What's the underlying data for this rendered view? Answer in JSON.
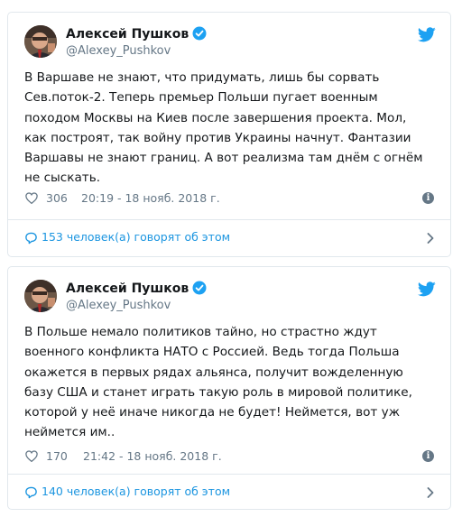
{
  "colors": {
    "link_blue": "#1b95e0",
    "twitter_blue": "#1da1f2",
    "text": "#14171a",
    "muted": "#657786",
    "border": "#e1e8ed"
  },
  "tweets": [
    {
      "author_name": "Алексей Пушков",
      "handle": "@Alexey_Pushkov",
      "verified": true,
      "text": "В Варшаве не знают, что придумать, лишь бы сорвать\nСев.поток-2. Теперь премьер Польши пугает военным\nпоходом Москвы на Киев после завершения проекта. Мол,\nкак построят, так войну против Украины начнут. Фантазии\nВаршавы не знают границ. А вот реализма там днём с огнём\nне сыскать.",
      "likes": "306",
      "timestamp": "20:19 - 18 нояб. 2018 г.",
      "conversation": "153 человек(а) говорят об этом",
      "icons": [
        "avatar",
        "verified-icon",
        "twitter-bird-icon",
        "heart-icon",
        "info-icon",
        "reply-bubble-icon",
        "chevron-right-icon"
      ]
    },
    {
      "author_name": "Алексей Пушков",
      "handle": "@Alexey_Pushkov",
      "verified": true,
      "text": "В Польше немало политиков тайно, но страстно ждут\nвоенного конфликта НАТО с Россией. Ведь тогда Польша\nокажется в первых рядах альянса, получит вожделенную\nбазу США и станет играть такую роль в мировой политике,\nкоторой у неё иначе никогда не будет! Неймется, вот уж\nнеймется им..",
      "likes": "170",
      "timestamp": "21:42 - 18 нояб. 2018 г.",
      "conversation": "140 человек(а) говорят об этом",
      "icons": [
        "avatar",
        "verified-icon",
        "twitter-bird-icon",
        "heart-icon",
        "info-icon",
        "reply-bubble-icon",
        "chevron-right-icon"
      ]
    }
  ]
}
